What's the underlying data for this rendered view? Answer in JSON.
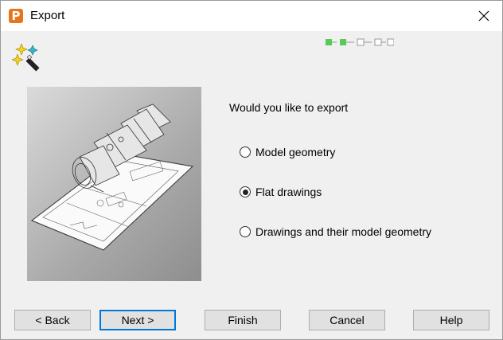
{
  "window": {
    "title": "Export",
    "app_icon_letter": "P"
  },
  "wizard": {
    "progress": {
      "total_steps": 5,
      "completed_steps": 2
    },
    "question": "Would you like to export",
    "options": [
      {
        "label": "Model geometry",
        "selected": false
      },
      {
        "label": "Flat drawings",
        "selected": true
      },
      {
        "label": "Drawings and their model geometry",
        "selected": false
      }
    ]
  },
  "buttons": {
    "back": "< Back",
    "next": "Next >",
    "finish": "Finish",
    "cancel": "Cancel",
    "help": "Help"
  },
  "colors": {
    "accent": "#0078d7",
    "app_icon": "#e8751a",
    "progress_done": "#59c959"
  }
}
